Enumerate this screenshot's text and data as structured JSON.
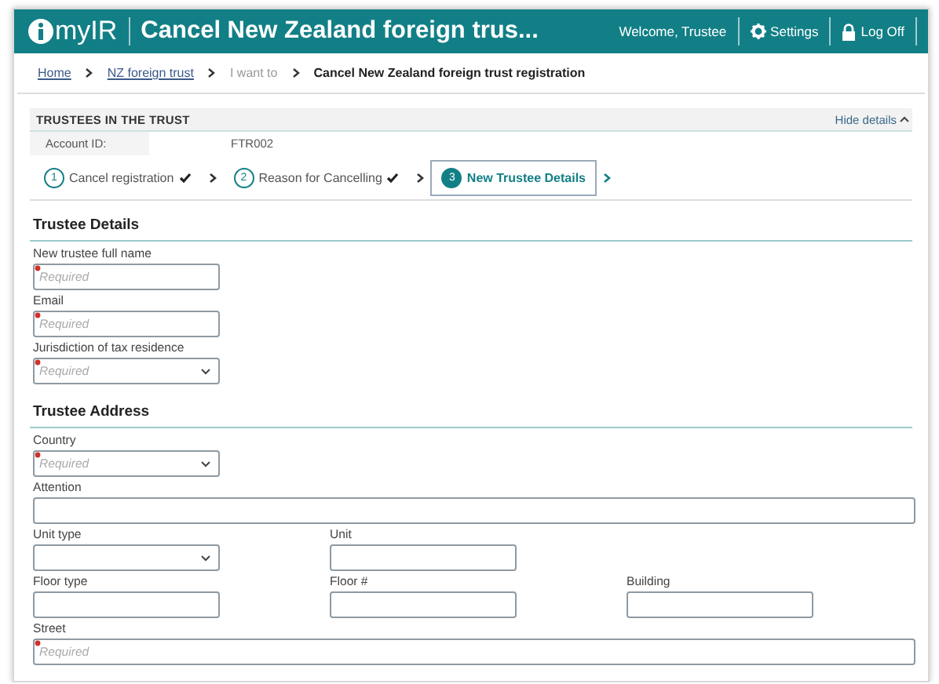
{
  "header": {
    "logo": "myIR",
    "title": "Cancel New Zealand foreign trus...",
    "welcome": "Welcome, Trustee",
    "settings": "Settings",
    "logoff": "Log Off"
  },
  "breadcrumb": [
    {
      "label": "Home",
      "kind": "link"
    },
    {
      "label": "NZ foreign trust",
      "kind": "link"
    },
    {
      "label": "I want to",
      "kind": "muted"
    },
    {
      "label": "Cancel New Zealand foreign trust registration",
      "kind": "current"
    }
  ],
  "trustees": {
    "title": "TRUSTEES IN THE TRUST",
    "toggle": "Hide details",
    "expanded": true,
    "account_label": "Account ID:",
    "account_value": "FTR002"
  },
  "steps": [
    {
      "number": "1",
      "label": "Cancel registration",
      "done": true,
      "selected": false
    },
    {
      "number": "2",
      "label": "Reason for Cancelling",
      "done": true,
      "selected": false
    },
    {
      "number": "3",
      "label": "New Trustee Details",
      "done": false,
      "selected": true
    }
  ],
  "sections": [
    {
      "heading": "Trustee Details",
      "rows": [
        [
          {
            "label": "New trustee full name",
            "kind": "text",
            "required": true,
            "placeholder": "Required",
            "wide": false
          }
        ],
        [
          {
            "label": "Email",
            "kind": "text",
            "required": true,
            "placeholder": "Required",
            "wide": false
          }
        ],
        [
          {
            "label": "Jurisdiction of tax residence",
            "kind": "select",
            "required": true,
            "placeholder": "Required",
            "wide": false
          }
        ]
      ]
    },
    {
      "heading": "Trustee Address",
      "rows": [
        [
          {
            "label": "Country",
            "kind": "select",
            "required": true,
            "placeholder": "Required",
            "wide": false
          }
        ],
        [
          {
            "label": "Attention",
            "kind": "text",
            "required": false,
            "wide": true
          }
        ],
        [
          {
            "label": "Unit type",
            "kind": "select",
            "required": false,
            "wide": false
          },
          {
            "label": "Unit",
            "kind": "text",
            "required": false,
            "wide": false
          }
        ],
        [
          {
            "label": "Floor type",
            "kind": "text",
            "required": false,
            "wide": false
          },
          {
            "label": "Floor #",
            "kind": "text",
            "required": false,
            "wide": false
          },
          {
            "label": "Building",
            "kind": "text",
            "required": false,
            "wide": false
          }
        ],
        [
          {
            "label": "Street",
            "kind": "text",
            "required": true,
            "placeholder": "Required",
            "wide": true
          }
        ]
      ]
    }
  ]
}
